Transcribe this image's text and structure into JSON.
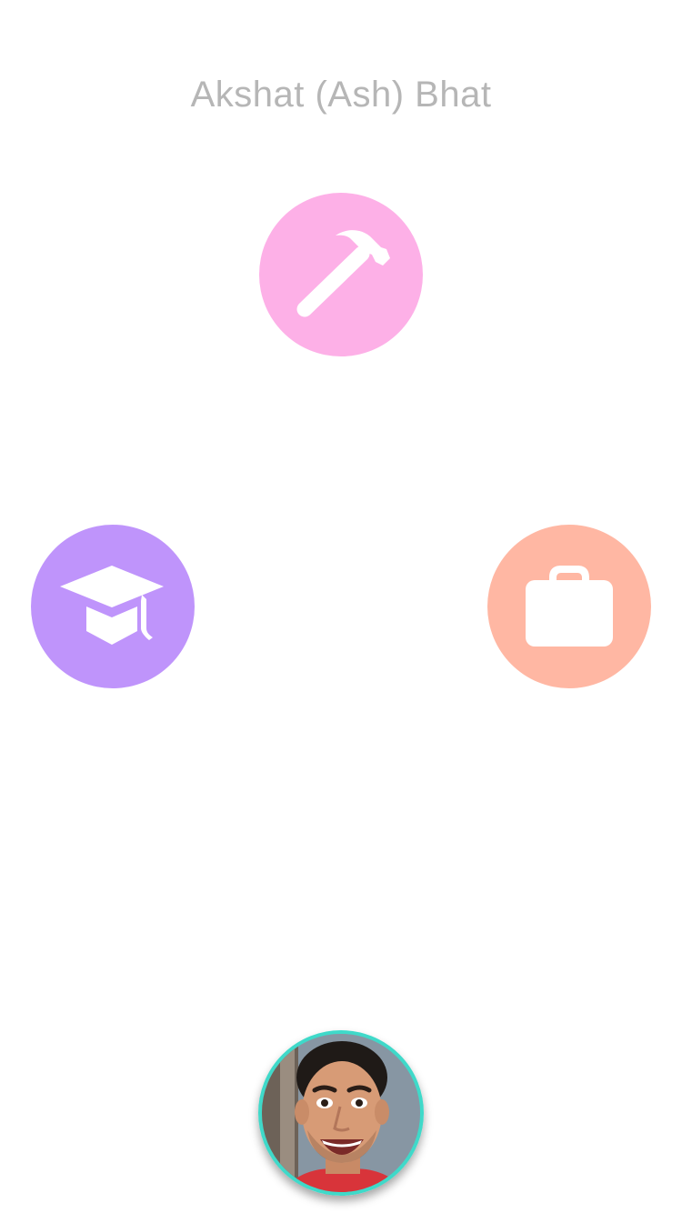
{
  "header": {
    "title": "Akshat (Ash) Bhat"
  },
  "nav": {
    "projects": {
      "icon": "hammer-icon",
      "color": "#fdb0e7"
    },
    "education": {
      "icon": "graduation-cap-icon",
      "color": "#bf94fb"
    },
    "work": {
      "icon": "briefcase-icon",
      "color": "#ffb7a3"
    }
  },
  "profile": {
    "avatar_border_color": "#3fd9c9"
  }
}
